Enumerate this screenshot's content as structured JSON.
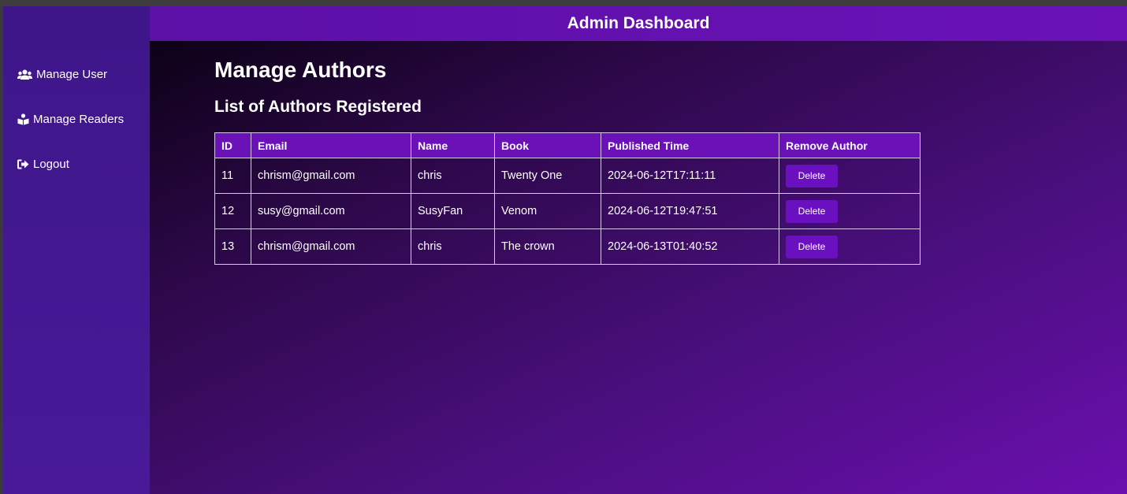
{
  "header": {
    "title": "Admin Dashboard"
  },
  "sidebar": {
    "items": [
      {
        "label": "Manage User",
        "icon": "users-icon"
      },
      {
        "label": "Manage Readers",
        "icon": "readers-icon"
      },
      {
        "label": "Logout",
        "icon": "logout-icon"
      }
    ]
  },
  "main": {
    "title": "Manage Authors",
    "subtitle": "List of Authors Registered",
    "table": {
      "columns": [
        "ID",
        "Email",
        "Name",
        "Book",
        "Published Time",
        "Remove Author"
      ],
      "rows": [
        {
          "id": "11",
          "email": "chrism@gmail.com",
          "name": "chris",
          "book": "Twenty One",
          "published": "2024-06-12T17:11:11",
          "action": "Delete"
        },
        {
          "id": "12",
          "email": "susy@gmail.com",
          "name": "SusyFan",
          "book": "Venom",
          "published": "2024-06-12T19:47:51",
          "action": "Delete"
        },
        {
          "id": "13",
          "email": "chrism@gmail.com",
          "name": "chris",
          "book": "The crown",
          "published": "2024-06-13T01:40:52",
          "action": "Delete"
        }
      ]
    }
  },
  "colors": {
    "sidebar": "#3e1689",
    "header": "#6a12b8",
    "button": "#6a10c0",
    "table_border": "#d8c6ee"
  }
}
